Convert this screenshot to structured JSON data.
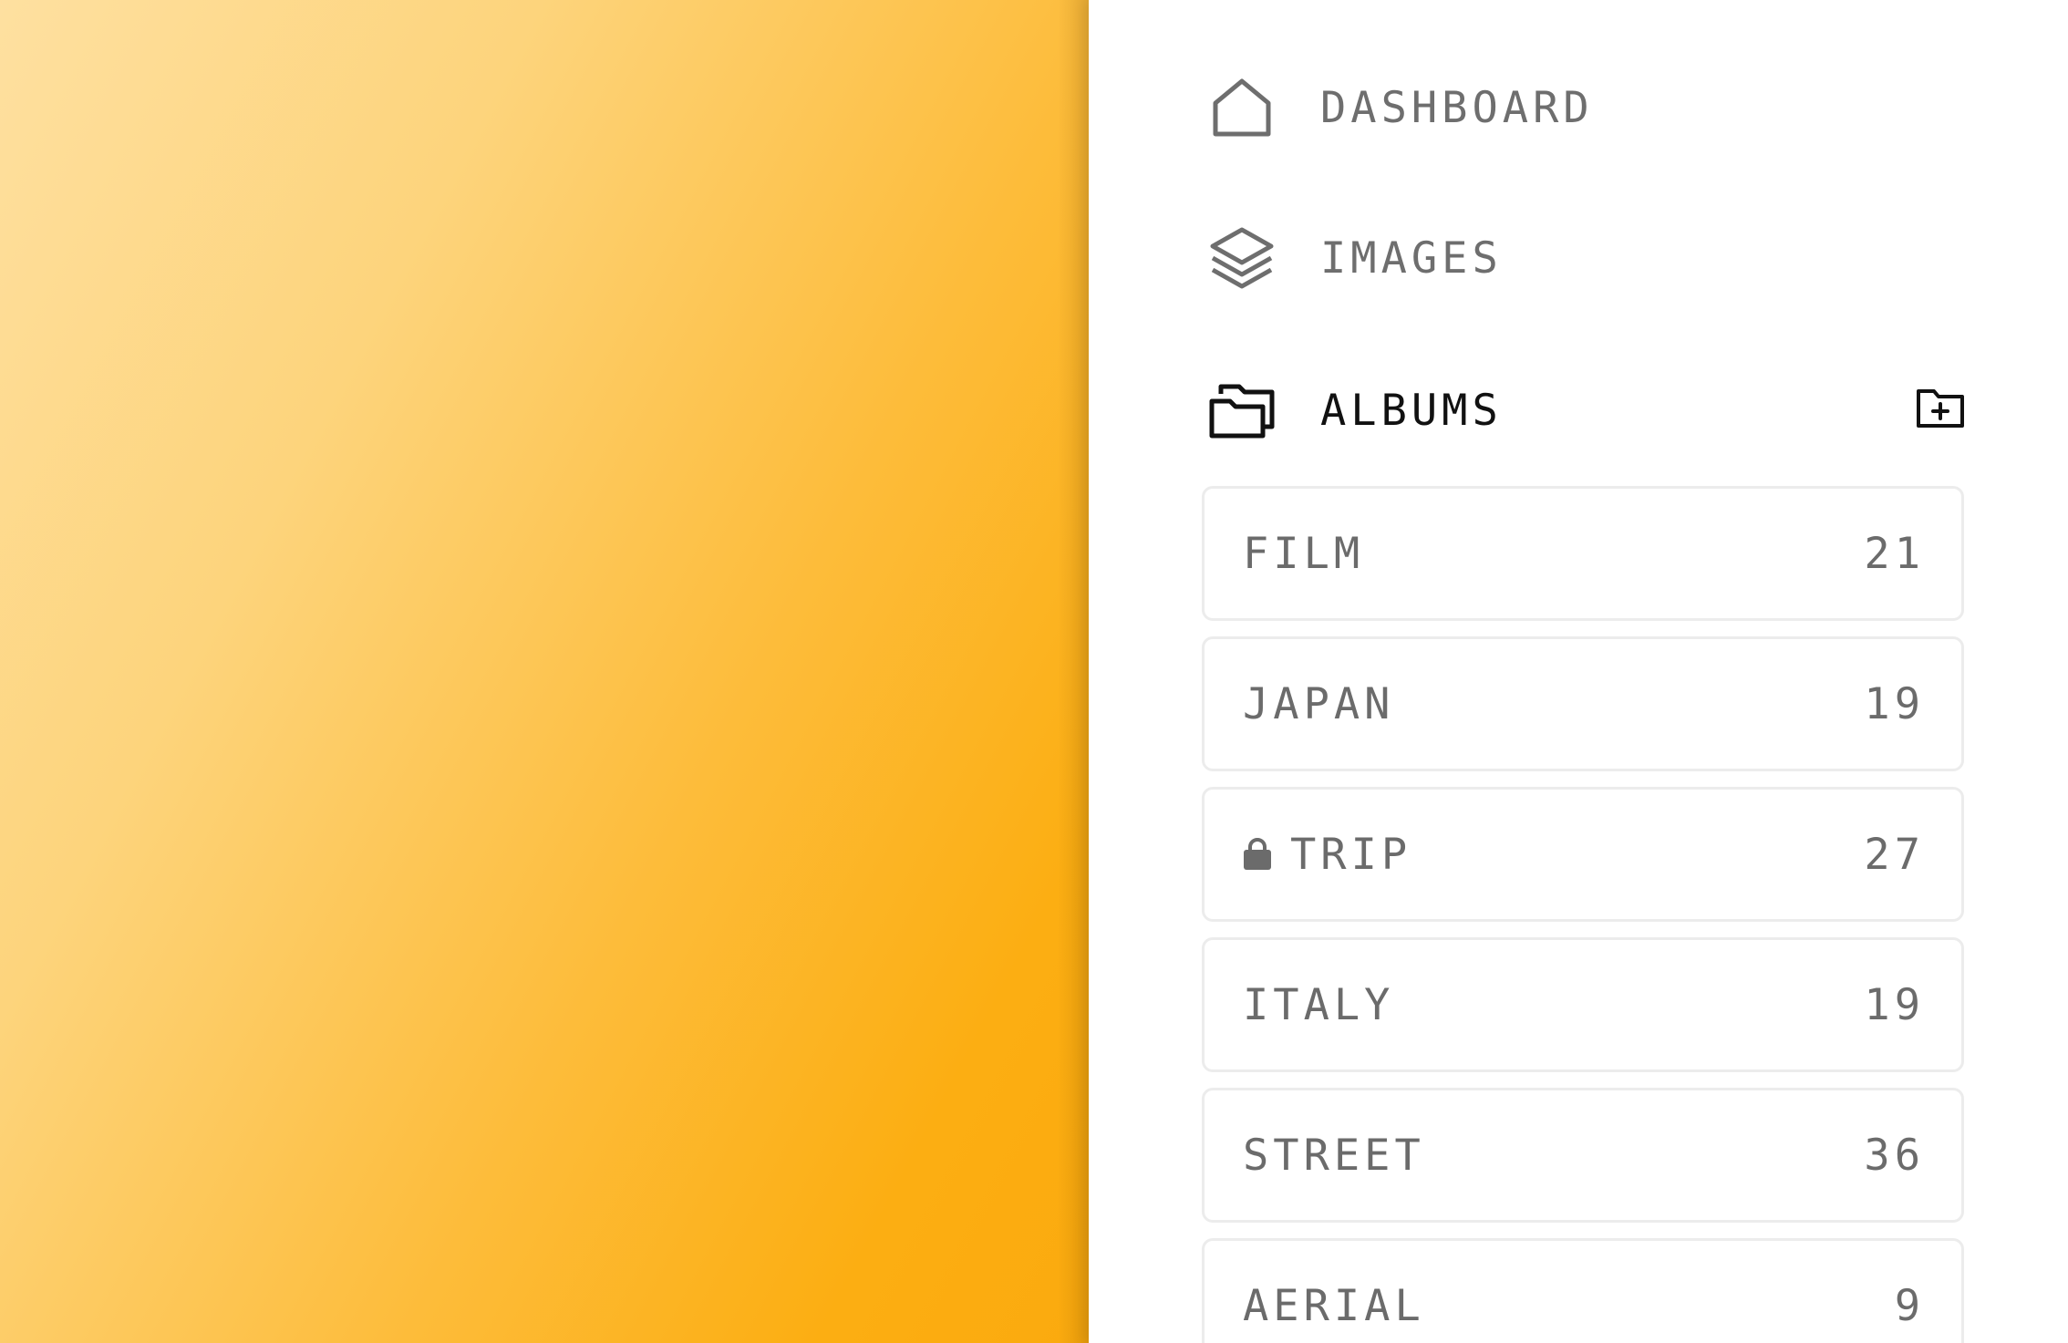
{
  "nav": {
    "dashboard": {
      "label": "DASHBOARD",
      "icon": "home-icon"
    },
    "images": {
      "label": "IMAGES",
      "icon": "layers-icon"
    },
    "albums": {
      "label": "ALBUMS",
      "icon": "folders-icon",
      "active": true
    }
  },
  "albums_header": {
    "add_icon": "folder-plus-icon"
  },
  "albums": [
    {
      "name": "FILM",
      "count": "21",
      "locked": false
    },
    {
      "name": "JAPAN",
      "count": "19",
      "locked": false
    },
    {
      "name": "TRIP",
      "count": "27",
      "locked": true
    },
    {
      "name": "ITALY",
      "count": "19",
      "locked": false
    },
    {
      "name": "STREET",
      "count": "36",
      "locked": false
    },
    {
      "name": "AERIAL",
      "count": "9",
      "locked": false
    }
  ],
  "colors": {
    "accent_gradient_start": "#fee0a0",
    "accent_gradient_end": "#fbaa0e",
    "text_muted": "#6e6e6e",
    "text_active": "#111111",
    "card_border": "#ececec"
  }
}
